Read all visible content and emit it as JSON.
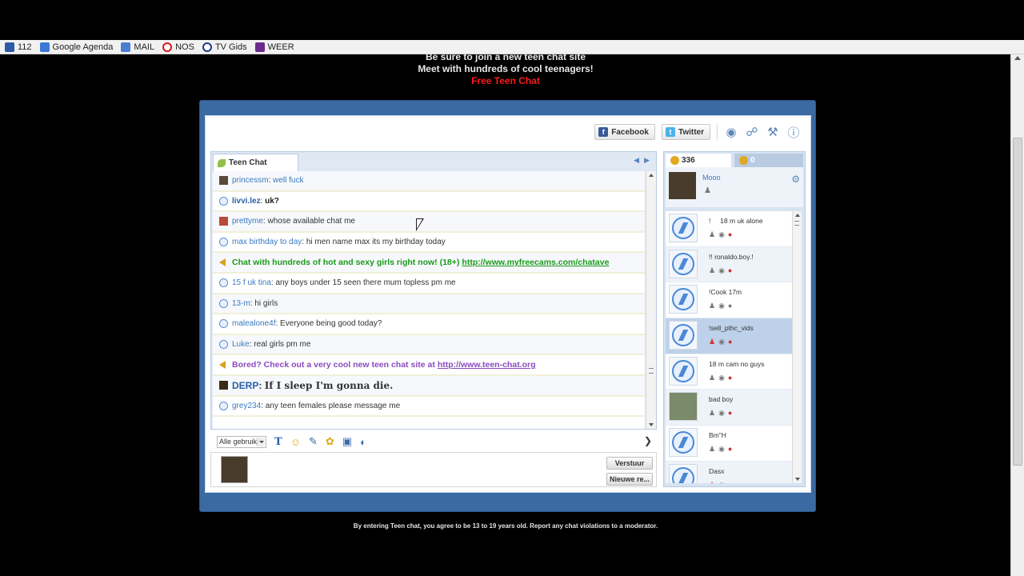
{
  "bookmarks": [
    {
      "label": "112",
      "icon": "bookmark-icon"
    },
    {
      "label": "Google Agenda",
      "icon": "calendar-icon"
    },
    {
      "label": "MAIL",
      "icon": "mail-icon"
    },
    {
      "label": "NOS",
      "icon": "nos-icon"
    },
    {
      "label": "TV Gids",
      "icon": "tv-icon"
    },
    {
      "label": "WEER",
      "icon": "weather-icon"
    }
  ],
  "banner": {
    "line1": "Be sure to join a new teen chat site",
    "line2": "Meet with hundreds of cool teenagers!",
    "link": "Free Teen Chat"
  },
  "toolbar": {
    "facebook_label": "Facebook",
    "twitter_label": "Twitter"
  },
  "chat": {
    "tab_label": "Teen Chat",
    "messages": [
      {
        "nick": "princessm",
        "text": "well fuck"
      },
      {
        "nick": "livvi.lez",
        "text": "uk?"
      },
      {
        "nick": "prettyme",
        "text": "whose available chat me"
      },
      {
        "nick": "max birthday to day",
        "text": "hi men name max its my birthday today"
      },
      {
        "promo": "Chat with hundreds of hot and sexy girls right now! (18+)",
        "link": "http://www.myfreecams.com/chatave"
      },
      {
        "nick": "15 f uk tina",
        "text": "any boys under 15 seen there mum topless pm me"
      },
      {
        "nick": "13-m",
        "text": "hi girls"
      },
      {
        "nick": "malealone4f",
        "text": "Everyone being good today?"
      },
      {
        "nick": "Luke",
        "text": "real girls pm me"
      },
      {
        "promo": "Bored? Check out a very cool new teen chat site at",
        "link": "http://www.teen-chat.org"
      },
      {
        "nick": "DERP",
        "text": "If I sleep I'm gonna die."
      },
      {
        "nick": "grey234",
        "text": "any teen females please message me"
      }
    ],
    "select_value": "Alle gebruik",
    "send_label": "Verstuur",
    "new_label": "Nieuwe re..."
  },
  "users": {
    "online_count": "336",
    "friends_count": "0",
    "me_name": "Mooo",
    "list": [
      {
        "name": "!     18 m uk alone"
      },
      {
        "name": "!! ronaldo.boy.!"
      },
      {
        "name": "!Cook 17m"
      },
      {
        "name": "!sell_pthc_vids"
      },
      {
        "name": "18 m cam no guys"
      },
      {
        "name": "bad boy"
      },
      {
        "name": "Bm\"H"
      },
      {
        "name": "Dasx"
      }
    ]
  },
  "footer": "By entering Teen chat, you agree to be 13 to 19 years old. Report any chat violations to a moderator."
}
